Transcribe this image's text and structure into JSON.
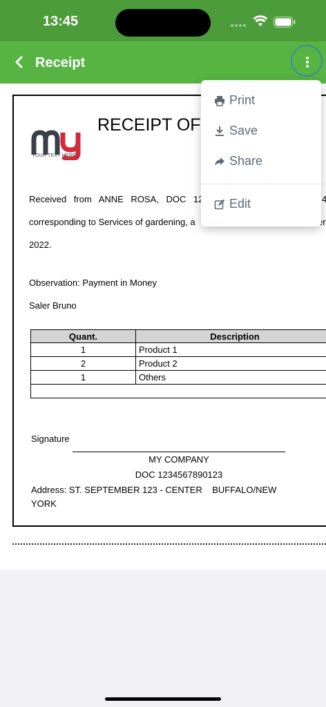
{
  "status": {
    "time": "13:45"
  },
  "app_bar": {
    "title": "Receipt"
  },
  "receipt": {
    "logo_caption": "YOUR TEXT HERE",
    "title": "RECEIPT OF",
    "line1": "Received from ANNE ROSA, DOC 123",
    "line1_tail": "4",
    "line2": "corresponding to Services of gardening, a",
    "line2_tail": "er",
    "line3": "2022.",
    "observation": "Observation: Payment in Money",
    "saler": "Saler Bruno",
    "table": {
      "headers": [
        "Quant.",
        "Description"
      ],
      "rows": [
        {
          "quant": "1",
          "desc": "Product 1"
        },
        {
          "quant": "2",
          "desc": "Product 2"
        },
        {
          "quant": "1",
          "desc": "Others"
        }
      ]
    },
    "signature_label": "Signature",
    "company": "MY COMPANY",
    "company_doc": "DOC 1234567890123",
    "address_line1": "Address: ST. SEPTEMBER 123 - CENTER    BUFFALO/NEW",
    "address_line2": "YORK"
  },
  "menu": {
    "items": [
      {
        "label": "Print",
        "icon": "print-icon"
      },
      {
        "label": "Save",
        "icon": "download-icon"
      },
      {
        "label": "Share",
        "icon": "share-icon"
      },
      {
        "label": "Edit",
        "icon": "edit-icon"
      }
    ]
  },
  "colors": {
    "status_bar": "#4d9c3b",
    "app_bar": "#57b442",
    "menu_text": "#5e6a73",
    "logo_dark": "#3a3f47",
    "logo_red": "#d22a3a"
  }
}
